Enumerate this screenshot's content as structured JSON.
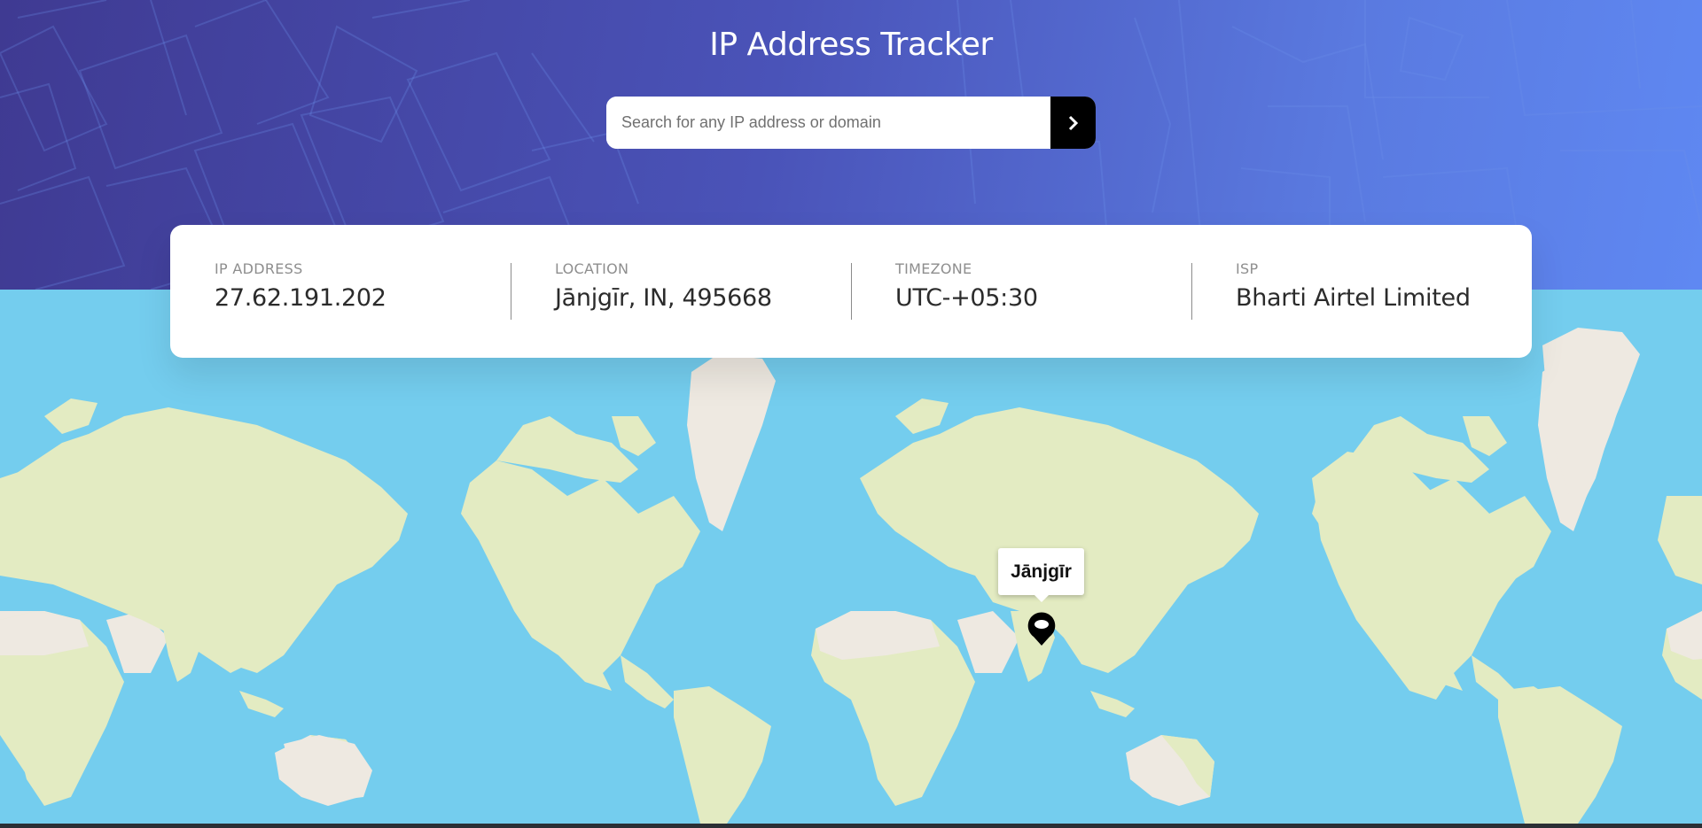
{
  "header": {
    "title": "IP Address Tracker",
    "search": {
      "placeholder": "Search for any IP address or domain",
      "value": "",
      "button_icon": "chevron-right-icon"
    }
  },
  "info": {
    "ip_address": {
      "label": "IP ADDRESS",
      "value": "27.62.191.202"
    },
    "location": {
      "label": "LOCATION",
      "value": "Jānjgīr, IN, 495668"
    },
    "timezone": {
      "label": "TIMEZONE",
      "value": "UTC-+05:30"
    },
    "isp": {
      "label": "ISP",
      "value": "Bharti Airtel Limited"
    }
  },
  "map": {
    "popup_label": "Jānjgīr",
    "marker_icon": "location-pin-icon"
  },
  "colors": {
    "header_gradient_start": "#3f3a92",
    "header_gradient_end": "#5f88f2",
    "ocean": "#74cdee",
    "land": "#e3ebc2",
    "desert": "#eee9e1",
    "search_button": "#000000",
    "text_dark": "#2b2b2b",
    "label_gray": "#8e8e8e"
  }
}
